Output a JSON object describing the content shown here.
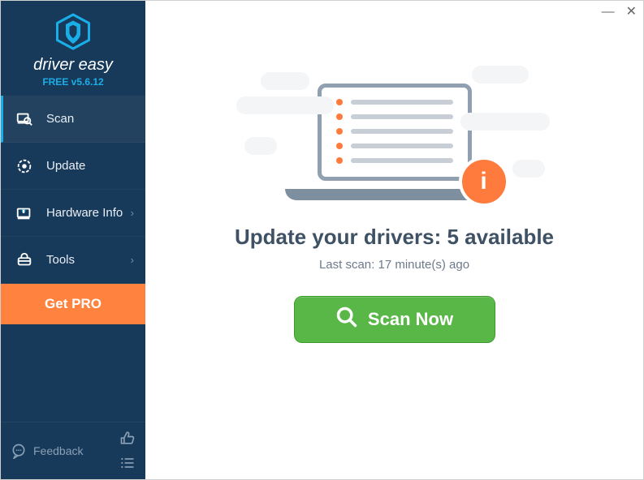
{
  "brand": {
    "name": "driver easy",
    "version": "FREE v5.6.12"
  },
  "sidebar": {
    "items": [
      {
        "label": "Scan",
        "icon": "scan-icon",
        "has_submenu": false,
        "active": true
      },
      {
        "label": "Update",
        "icon": "update-icon",
        "has_submenu": false,
        "active": false
      },
      {
        "label": "Hardware Info",
        "icon": "hardware-icon",
        "has_submenu": true,
        "active": false
      },
      {
        "label": "Tools",
        "icon": "tools-icon",
        "has_submenu": true,
        "active": false
      }
    ],
    "get_pro": "Get PRO",
    "feedback": "Feedback"
  },
  "main": {
    "heading": "Update your drivers: 5 available",
    "subtext": "Last scan: 17 minute(s) ago",
    "scan_label": "Scan Now",
    "info_badge": "i"
  },
  "window": {
    "minimize": "—",
    "close": "✕"
  }
}
